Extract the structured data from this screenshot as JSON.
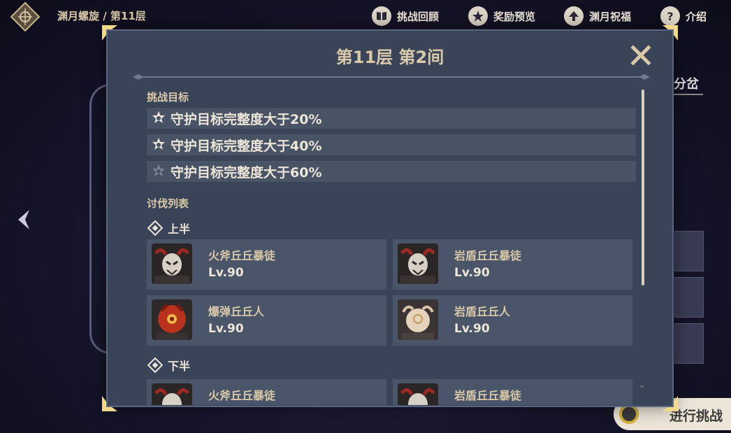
{
  "topbar": {
    "breadcrumb": "渊月螺旋 / 第11层",
    "items": [
      {
        "label": "挑战回顾",
        "icon": "book-icon"
      },
      {
        "label": "奖励预览",
        "icon": "star-badge-icon"
      },
      {
        "label": "渊月祝福",
        "icon": "blessing-up-icon"
      },
      {
        "label": "介绍",
        "icon": "help-icon"
      }
    ]
  },
  "background": {
    "branch_label": "分岔",
    "start_button_label": "进行挑战"
  },
  "modal": {
    "title": "第11层 第2间",
    "goals_label": "挑战目标",
    "goals": [
      {
        "text": "守护目标完整度大于20%",
        "achieved": true
      },
      {
        "text": "守护目标完整度大于40%",
        "achieved": true
      },
      {
        "text": "守护目标完整度大于60%",
        "achieved": false
      }
    ],
    "enemies_label": "讨伐列表",
    "first_half": {
      "label": "上半",
      "enemies": [
        {
          "name": "火斧丘丘暴徒",
          "level": "Lv.90",
          "portrait": "hilichurl-mitachurl-icon"
        },
        {
          "name": "岩盾丘丘暴徒",
          "level": "Lv.90",
          "portrait": "hilichurl-mitachurl-icon"
        },
        {
          "name": "爆弹丘丘人",
          "level": "Lv.90",
          "portrait": "pyro-hilichurl-icon"
        },
        {
          "name": "岩盾丘丘人",
          "level": "Lv.90",
          "portrait": "geo-hilichurl-icon"
        }
      ]
    },
    "second_half": {
      "label": "下半",
      "enemies": [
        {
          "name": "火斧丘丘暴徒",
          "portrait": "hilichurl-mitachurl-icon"
        },
        {
          "name": "岩盾丘丘暴徒",
          "portrait": "hilichurl-mitachurl-icon"
        }
      ]
    }
  },
  "colors": {
    "modal_bg": "#3a4459",
    "gold_text": "#d9c9a8",
    "light_text": "#ece5d8"
  }
}
